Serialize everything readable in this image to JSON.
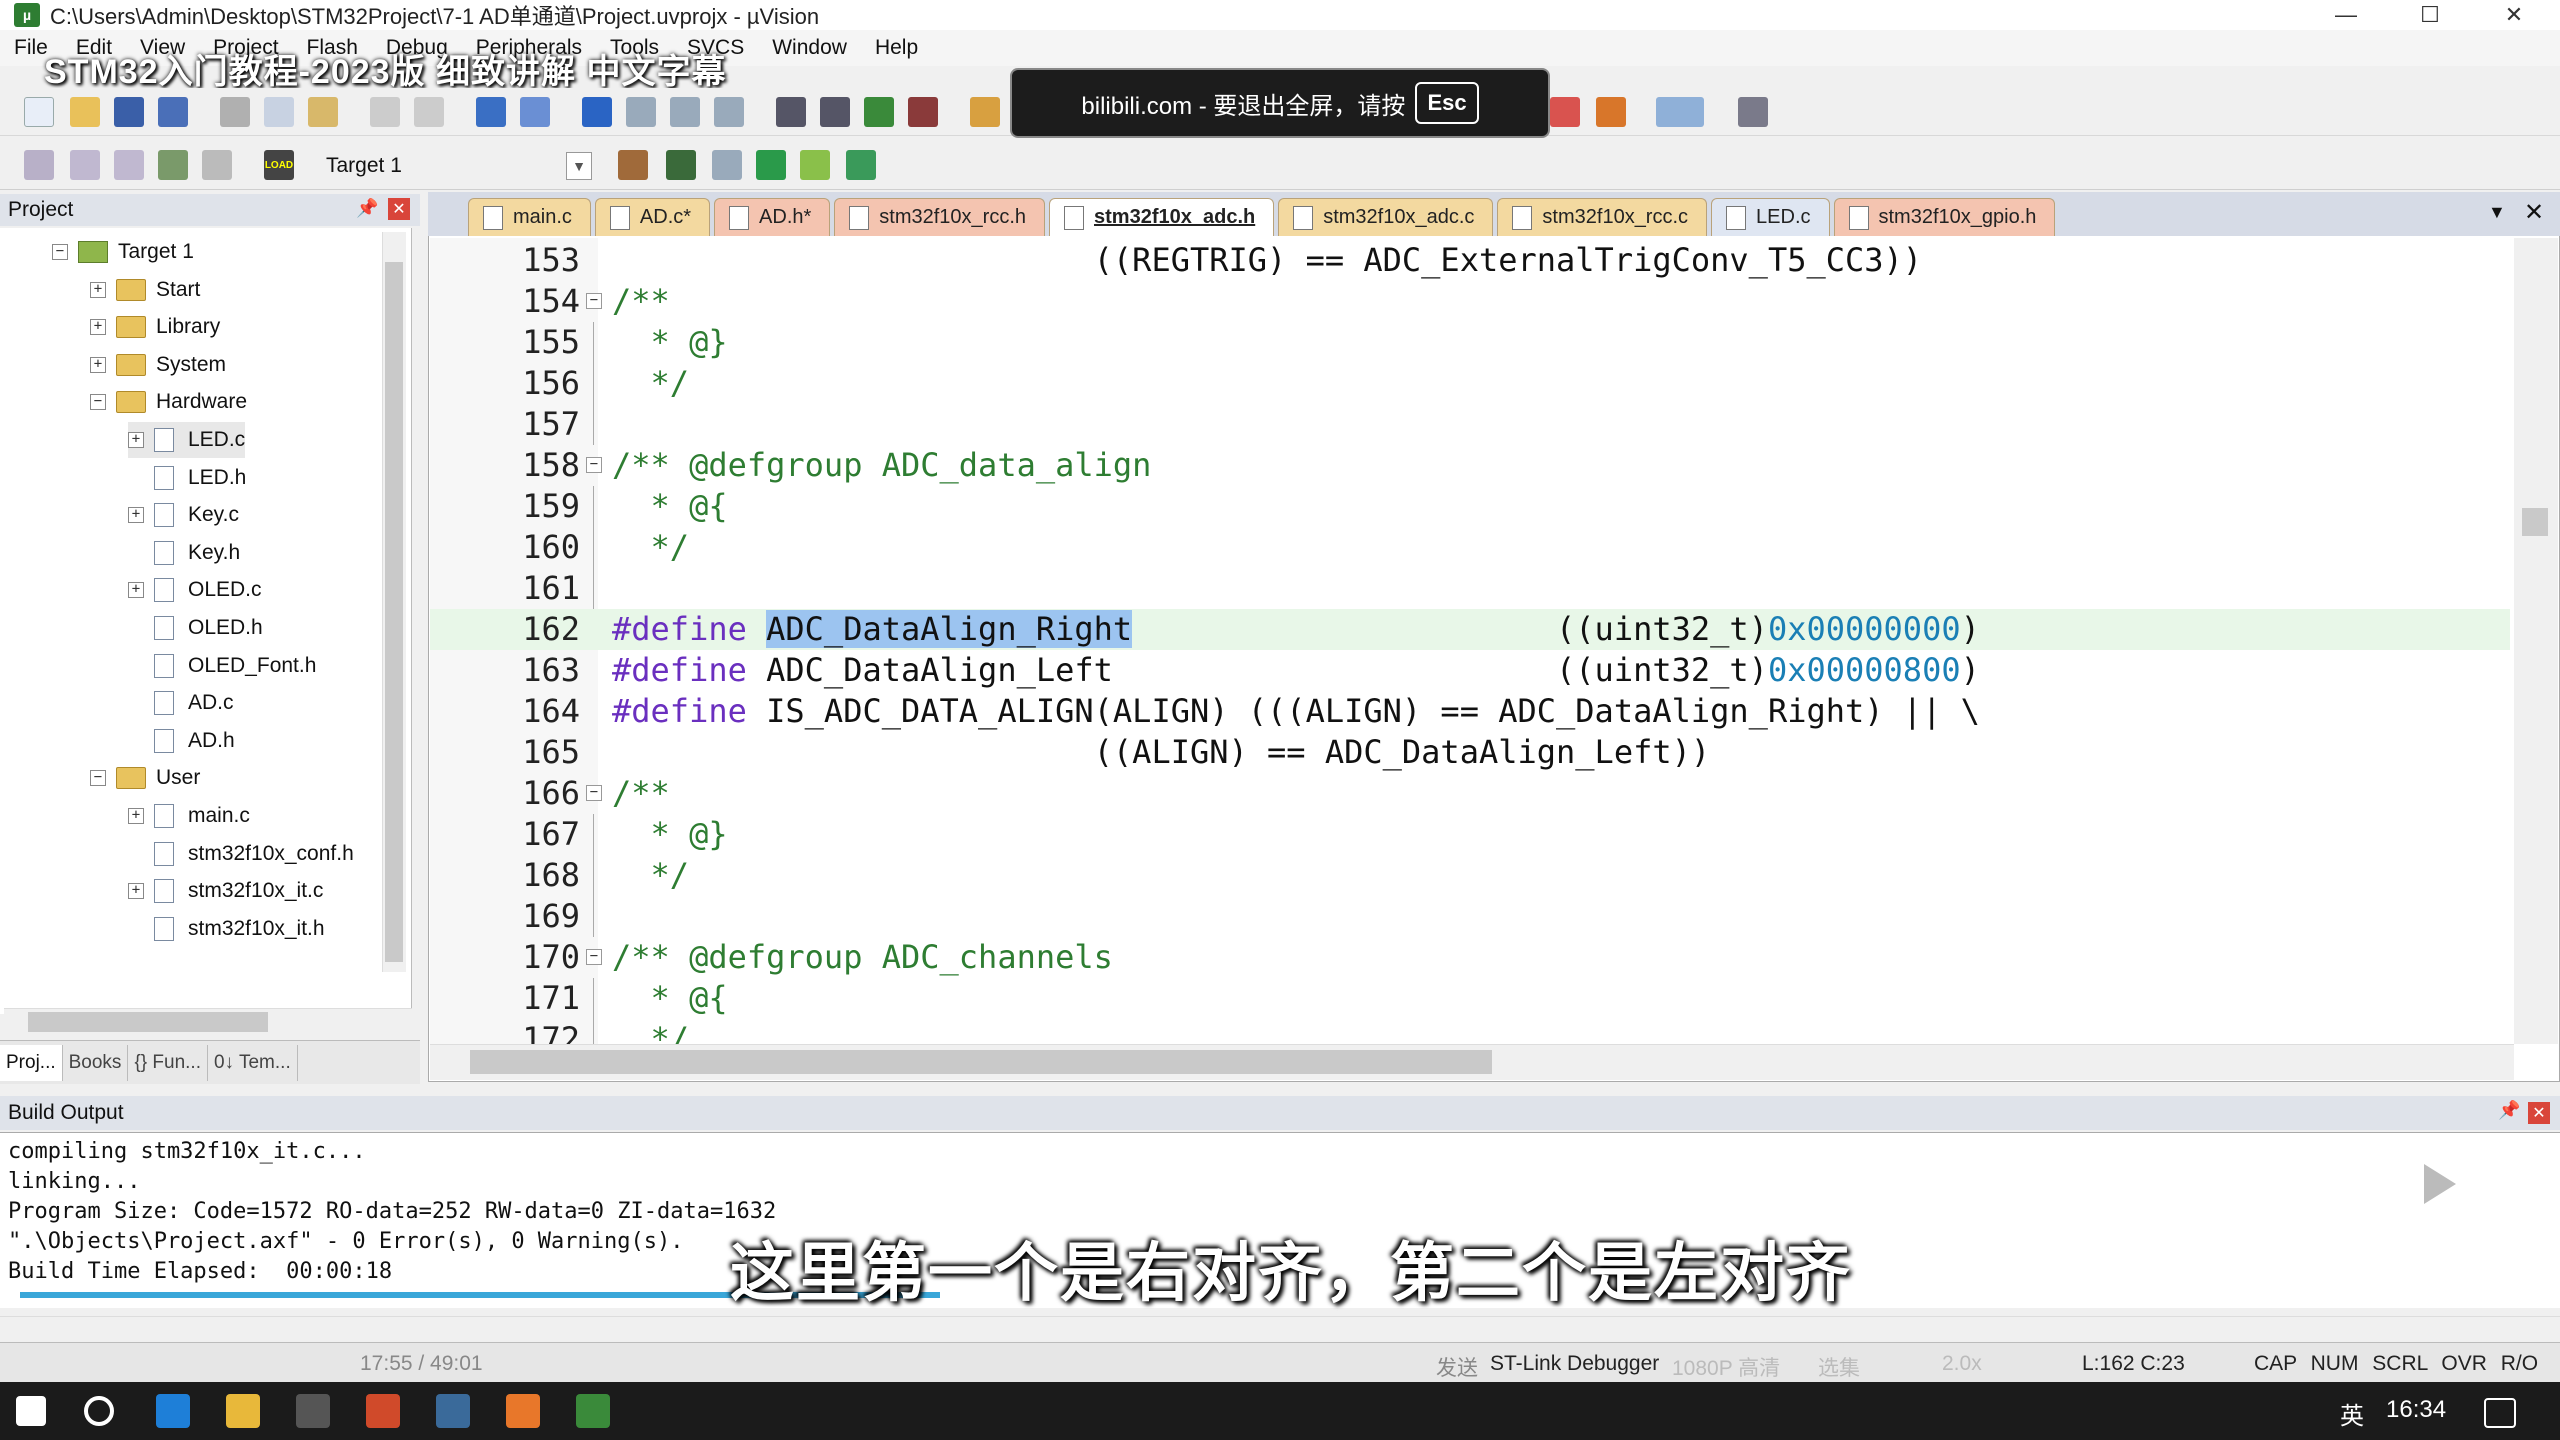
{
  "window": {
    "title": "C:\\Users\\Admin\\Desktop\\STM32Project\\7-1 AD单通道\\Project.uvprojx - µVision",
    "minimize": "—",
    "maximize": "☐",
    "close": "✕"
  },
  "overlay_title": "STM32入门教程-2023版 细致讲解 中文字幕",
  "menu": [
    "File",
    "Edit",
    "View",
    "Project",
    "Flash",
    "Debug",
    "Peripherals",
    "Tools",
    "SVCS",
    "Window",
    "Help"
  ],
  "toolbar": {
    "target_label": "Target 1",
    "load_label": "LOAD"
  },
  "esc_banner": {
    "text": "bilibili.com - 要退出全屏，请按",
    "key": "Esc"
  },
  "project_panel": {
    "title": "Project",
    "tree": [
      {
        "label": "Target 1",
        "level": 0,
        "type": "target",
        "expander": "−"
      },
      {
        "label": "Start",
        "level": 1,
        "type": "folder",
        "expander": "+"
      },
      {
        "label": "Library",
        "level": 1,
        "type": "folder",
        "expander": "+"
      },
      {
        "label": "System",
        "level": 1,
        "type": "folder",
        "expander": "+"
      },
      {
        "label": "Hardware",
        "level": 1,
        "type": "folder",
        "expander": "−"
      },
      {
        "label": "LED.c",
        "level": 2,
        "type": "file",
        "expander": "+"
      },
      {
        "label": "LED.h",
        "level": 2,
        "type": "file",
        "expander": ""
      },
      {
        "label": "Key.c",
        "level": 2,
        "type": "file",
        "expander": "+"
      },
      {
        "label": "Key.h",
        "level": 2,
        "type": "file",
        "expander": ""
      },
      {
        "label": "OLED.c",
        "level": 2,
        "type": "file",
        "expander": "+"
      },
      {
        "label": "OLED.h",
        "level": 2,
        "type": "file",
        "expander": ""
      },
      {
        "label": "OLED_Font.h",
        "level": 2,
        "type": "file",
        "expander": ""
      },
      {
        "label": "AD.c",
        "level": 2,
        "type": "file",
        "expander": ""
      },
      {
        "label": "AD.h",
        "level": 2,
        "type": "file",
        "expander": ""
      },
      {
        "label": "User",
        "level": 1,
        "type": "folder",
        "expander": "−"
      },
      {
        "label": "main.c",
        "level": 2,
        "type": "file",
        "expander": "+"
      },
      {
        "label": "stm32f10x_conf.h",
        "level": 2,
        "type": "file",
        "expander": ""
      },
      {
        "label": "stm32f10x_it.c",
        "level": 2,
        "type": "file",
        "expander": "+"
      },
      {
        "label": "stm32f10x_it.h",
        "level": 2,
        "type": "file",
        "expander": ""
      }
    ],
    "tabs": [
      "Proj...",
      "Books",
      "{} Fun...",
      "0↓ Tem..."
    ]
  },
  "file_tabs": [
    {
      "label": "main.c",
      "color": "#f3d9a0",
      "active": false
    },
    {
      "label": "AD.c*",
      "color": "#f3d9a0",
      "active": false
    },
    {
      "label": "AD.h*",
      "color": "#f4c4b0",
      "active": false
    },
    {
      "label": "stm32f10x_rcc.h",
      "color": "#f4c4b0",
      "active": false
    },
    {
      "label": "stm32f10x_adc.h",
      "color": "#ffffff",
      "active": true
    },
    {
      "label": "stm32f10x_adc.c",
      "color": "#f3d9a0",
      "active": false
    },
    {
      "label": "stm32f10x_rcc.c",
      "color": "#f3d9a0",
      "active": false
    },
    {
      "label": "LED.c",
      "color": "#dfe6f2",
      "active": false
    },
    {
      "label": "stm32f10x_gpio.h",
      "color": "#f4c4b0",
      "active": false
    }
  ],
  "code_lines": [
    {
      "num": "153",
      "fold": "",
      "segs": [
        {
          "t": "                         ((REGTRIG) == ADC_ExternalTrigConv_T5_CC3))",
          "c": ""
        }
      ]
    },
    {
      "num": "154",
      "fold": "−",
      "segs": [
        {
          "t": "/**",
          "c": "cm"
        }
      ]
    },
    {
      "num": "155",
      "fold": "|",
      "segs": [
        {
          "t": "  * @}",
          "c": "cm"
        }
      ]
    },
    {
      "num": "156",
      "fold": "|",
      "segs": [
        {
          "t": "  */",
          "c": "cm"
        }
      ]
    },
    {
      "num": "157",
      "fold": "|",
      "segs": [
        {
          "t": "",
          "c": ""
        }
      ]
    },
    {
      "num": "158",
      "fold": "−",
      "segs": [
        {
          "t": "/** @defgroup ADC_data_align",
          "c": "cm"
        }
      ]
    },
    {
      "num": "159",
      "fold": "|",
      "segs": [
        {
          "t": "  * @{",
          "c": "cm"
        }
      ]
    },
    {
      "num": "160",
      "fold": "|",
      "segs": [
        {
          "t": "  */",
          "c": "cm"
        }
      ]
    },
    {
      "num": "161",
      "fold": "|",
      "segs": [
        {
          "t": "",
          "c": ""
        }
      ]
    },
    {
      "num": "162",
      "fold": "",
      "hl": true,
      "segs": [
        {
          "t": "#define",
          "c": "pp"
        },
        {
          "t": " ",
          "c": ""
        },
        {
          "t": "ADC_DataAlign_Right",
          "c": "sel"
        },
        {
          "t": "                      ((uint32_t)",
          "c": ""
        },
        {
          "t": "0x00000000",
          "c": "hx"
        },
        {
          "t": ")",
          "c": ""
        }
      ]
    },
    {
      "num": "163",
      "fold": "",
      "segs": [
        {
          "t": "#define",
          "c": "pp"
        },
        {
          "t": " ADC_DataAlign_Left                       ((uint32_t)",
          "c": ""
        },
        {
          "t": "0x00000800",
          "c": "hx"
        },
        {
          "t": ")",
          "c": ""
        }
      ]
    },
    {
      "num": "164",
      "fold": "",
      "segs": [
        {
          "t": "#define",
          "c": "pp"
        },
        {
          "t": " IS_ADC_DATA_ALIGN(ALIGN) (((ALIGN) == ADC_DataAlign_Right) || \\",
          "c": ""
        }
      ]
    },
    {
      "num": "165",
      "fold": "",
      "segs": [
        {
          "t": "                         ((ALIGN) == ADC_DataAlign_Left))",
          "c": ""
        }
      ]
    },
    {
      "num": "166",
      "fold": "−",
      "segs": [
        {
          "t": "/**",
          "c": "cm"
        }
      ]
    },
    {
      "num": "167",
      "fold": "|",
      "segs": [
        {
          "t": "  * @}",
          "c": "cm"
        }
      ]
    },
    {
      "num": "168",
      "fold": "|",
      "segs": [
        {
          "t": "  */",
          "c": "cm"
        }
      ]
    },
    {
      "num": "169",
      "fold": "|",
      "segs": [
        {
          "t": "",
          "c": ""
        }
      ]
    },
    {
      "num": "170",
      "fold": "−",
      "segs": [
        {
          "t": "/** @defgroup ADC_channels",
          "c": "cm"
        }
      ]
    },
    {
      "num": "171",
      "fold": "|",
      "segs": [
        {
          "t": "  * @{",
          "c": "cm"
        }
      ]
    },
    {
      "num": "172",
      "fold": "|",
      "segs": [
        {
          "t": "  */",
          "c": "cm"
        }
      ]
    }
  ],
  "build_output": {
    "title": "Build Output",
    "lines": [
      "compiling stm32f10x_it.c...",
      "linking...",
      "Program Size: Code=1572 RO-data=252 RW-data=0 ZI-data=1632",
      "\".\\Objects\\Project.axf\" - 0 Error(s), 0 Warning(s).",
      "Build Time Elapsed:  00:00:18"
    ]
  },
  "subtitle": "这里第一个是右对齐，第二个是左对齐",
  "statusbar": {
    "debugger": "ST-Link Debugger",
    "position": "L:162 C:23",
    "flags": "CAP NUM SCRL OVR R/O",
    "player_time": "17:55 / 49:01",
    "player_send": "发送",
    "player_quality": "1080P 高清",
    "player_select": "选集",
    "player_speed": "2.0x"
  },
  "taskbar": {
    "clock": "16:34",
    "lang": "英"
  },
  "colors": {
    "comment": "#2e7d32",
    "preprocessor": "#6a2fbf",
    "hex": "#1a7fb5",
    "selection": "#9cc4f0",
    "line_highlight": "#e8f7e8"
  }
}
